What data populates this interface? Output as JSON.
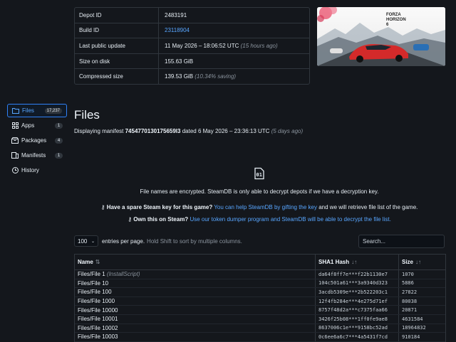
{
  "info": {
    "rows": [
      {
        "label": "Depot ID",
        "value": "2483191",
        "note": ""
      },
      {
        "label": "Build ID",
        "value": "23118904",
        "note": ""
      },
      {
        "label": "Last public update",
        "value": "11 May 2026 – 18:06:52 UTC",
        "note": "(15 hours ago)"
      },
      {
        "label": "Size on disk",
        "value": "155.63 GiB",
        "note": ""
      },
      {
        "label": "Compressed size",
        "value": "139.53 GiB",
        "note": "(10.34% saving)"
      }
    ]
  },
  "game_art": {
    "logo_text": "FORZA HORIZON 6"
  },
  "sidebar": {
    "items": [
      {
        "label": "Files",
        "badge": "17,237",
        "icon": "folder-icon"
      },
      {
        "label": "Apps",
        "badge": "1",
        "icon": "apps-icon"
      },
      {
        "label": "Packages",
        "badge": "4",
        "icon": "packages-icon"
      },
      {
        "label": "Manifests",
        "badge": "1",
        "icon": "manifests-icon"
      },
      {
        "label": "History",
        "badge": "",
        "icon": "history-icon"
      }
    ]
  },
  "files": {
    "title": "Files",
    "manifest_prefix": "Displaying manifest",
    "manifest_id": "7454770130175659l3",
    "manifest_dated": "dated 6 May 2026 – 23:36:13 UTC",
    "manifest_ago": "(5 days ago)"
  },
  "notice": {
    "line1": "File names are encrypted. SteamDB is only able to decrypt depots if we have a decryption key.",
    "line2_bold": "Have a spare Steam key for this game?",
    "line2_link": "You can help SteamDB by gifting the key",
    "line2_rest": "and we will retrieve file list of the game.",
    "line3_bold": "Own this on Steam?",
    "line3_link": "Use our token dumper program and SteamDB will be able to decrypt the file list."
  },
  "table_controls": {
    "entries_value": "100",
    "entries_label": "entries per page.",
    "entries_hint": "Hold Shift to sort by multiple columns.",
    "search_placeholder": "Search..."
  },
  "table": {
    "headers": {
      "name": "Name",
      "hash": "SHA1 Hash",
      "size": "Size"
    },
    "rows": [
      {
        "name": "Files/File 1",
        "tag": "(InstallScript)",
        "hash": "da64f8ff7e***f22b1130e7",
        "size": "1070"
      },
      {
        "name": "Files/File 10",
        "tag": "",
        "hash": "104c501a61***3a9340d323",
        "size": "5886"
      },
      {
        "name": "Files/File 100",
        "tag": "",
        "hash": "3acdb5309e***2b522203c1",
        "size": "27822"
      },
      {
        "name": "Files/File 1000",
        "tag": "",
        "hash": "12f4fb284e***4e275d71ef",
        "size": "80038"
      },
      {
        "name": "Files/File 10000",
        "tag": "",
        "hash": "8757f48d2a***c7375faa66",
        "size": "20871"
      },
      {
        "name": "Files/File 10001",
        "tag": "",
        "hash": "3426f25b08***1ff0fe9ae8",
        "size": "4631584"
      },
      {
        "name": "Files/File 10002",
        "tag": "",
        "hash": "8637006c1e***9158bc52ad",
        "size": "18964832"
      },
      {
        "name": "Files/File 10003",
        "tag": "",
        "hash": "0c6ee6a6c7***4a5431f7cd",
        "size": "910184"
      }
    ]
  }
}
